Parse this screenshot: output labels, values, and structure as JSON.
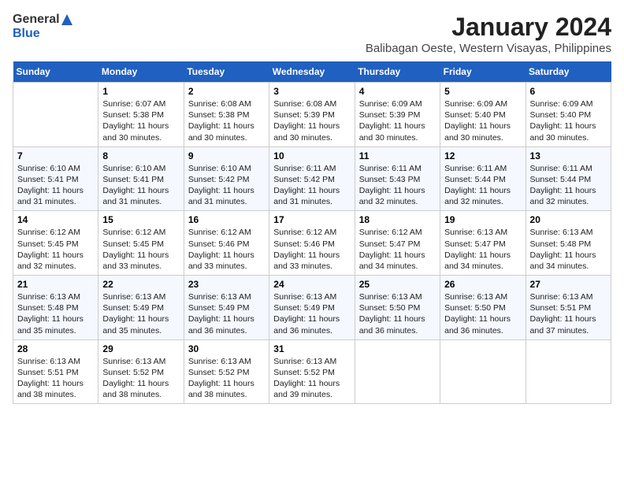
{
  "logo": {
    "line1": "General",
    "line2": "Blue"
  },
  "title": "January 2024",
  "subtitle": "Balibagan Oeste, Western Visayas, Philippines",
  "days_of_week": [
    "Sunday",
    "Monday",
    "Tuesday",
    "Wednesday",
    "Thursday",
    "Friday",
    "Saturday"
  ],
  "weeks": [
    [
      {
        "num": "",
        "sunrise": "",
        "sunset": "",
        "daylight": ""
      },
      {
        "num": "1",
        "sunrise": "Sunrise: 6:07 AM",
        "sunset": "Sunset: 5:38 PM",
        "daylight": "Daylight: 11 hours and 30 minutes."
      },
      {
        "num": "2",
        "sunrise": "Sunrise: 6:08 AM",
        "sunset": "Sunset: 5:38 PM",
        "daylight": "Daylight: 11 hours and 30 minutes."
      },
      {
        "num": "3",
        "sunrise": "Sunrise: 6:08 AM",
        "sunset": "Sunset: 5:39 PM",
        "daylight": "Daylight: 11 hours and 30 minutes."
      },
      {
        "num": "4",
        "sunrise": "Sunrise: 6:09 AM",
        "sunset": "Sunset: 5:39 PM",
        "daylight": "Daylight: 11 hours and 30 minutes."
      },
      {
        "num": "5",
        "sunrise": "Sunrise: 6:09 AM",
        "sunset": "Sunset: 5:40 PM",
        "daylight": "Daylight: 11 hours and 30 minutes."
      },
      {
        "num": "6",
        "sunrise": "Sunrise: 6:09 AM",
        "sunset": "Sunset: 5:40 PM",
        "daylight": "Daylight: 11 hours and 30 minutes."
      }
    ],
    [
      {
        "num": "7",
        "sunrise": "Sunrise: 6:10 AM",
        "sunset": "Sunset: 5:41 PM",
        "daylight": "Daylight: 11 hours and 31 minutes."
      },
      {
        "num": "8",
        "sunrise": "Sunrise: 6:10 AM",
        "sunset": "Sunset: 5:41 PM",
        "daylight": "Daylight: 11 hours and 31 minutes."
      },
      {
        "num": "9",
        "sunrise": "Sunrise: 6:10 AM",
        "sunset": "Sunset: 5:42 PM",
        "daylight": "Daylight: 11 hours and 31 minutes."
      },
      {
        "num": "10",
        "sunrise": "Sunrise: 6:11 AM",
        "sunset": "Sunset: 5:42 PM",
        "daylight": "Daylight: 11 hours and 31 minutes."
      },
      {
        "num": "11",
        "sunrise": "Sunrise: 6:11 AM",
        "sunset": "Sunset: 5:43 PM",
        "daylight": "Daylight: 11 hours and 32 minutes."
      },
      {
        "num": "12",
        "sunrise": "Sunrise: 6:11 AM",
        "sunset": "Sunset: 5:44 PM",
        "daylight": "Daylight: 11 hours and 32 minutes."
      },
      {
        "num": "13",
        "sunrise": "Sunrise: 6:11 AM",
        "sunset": "Sunset: 5:44 PM",
        "daylight": "Daylight: 11 hours and 32 minutes."
      }
    ],
    [
      {
        "num": "14",
        "sunrise": "Sunrise: 6:12 AM",
        "sunset": "Sunset: 5:45 PM",
        "daylight": "Daylight: 11 hours and 32 minutes."
      },
      {
        "num": "15",
        "sunrise": "Sunrise: 6:12 AM",
        "sunset": "Sunset: 5:45 PM",
        "daylight": "Daylight: 11 hours and 33 minutes."
      },
      {
        "num": "16",
        "sunrise": "Sunrise: 6:12 AM",
        "sunset": "Sunset: 5:46 PM",
        "daylight": "Daylight: 11 hours and 33 minutes."
      },
      {
        "num": "17",
        "sunrise": "Sunrise: 6:12 AM",
        "sunset": "Sunset: 5:46 PM",
        "daylight": "Daylight: 11 hours and 33 minutes."
      },
      {
        "num": "18",
        "sunrise": "Sunrise: 6:12 AM",
        "sunset": "Sunset: 5:47 PM",
        "daylight": "Daylight: 11 hours and 34 minutes."
      },
      {
        "num": "19",
        "sunrise": "Sunrise: 6:13 AM",
        "sunset": "Sunset: 5:47 PM",
        "daylight": "Daylight: 11 hours and 34 minutes."
      },
      {
        "num": "20",
        "sunrise": "Sunrise: 6:13 AM",
        "sunset": "Sunset: 5:48 PM",
        "daylight": "Daylight: 11 hours and 34 minutes."
      }
    ],
    [
      {
        "num": "21",
        "sunrise": "Sunrise: 6:13 AM",
        "sunset": "Sunset: 5:48 PM",
        "daylight": "Daylight: 11 hours and 35 minutes."
      },
      {
        "num": "22",
        "sunrise": "Sunrise: 6:13 AM",
        "sunset": "Sunset: 5:49 PM",
        "daylight": "Daylight: 11 hours and 35 minutes."
      },
      {
        "num": "23",
        "sunrise": "Sunrise: 6:13 AM",
        "sunset": "Sunset: 5:49 PM",
        "daylight": "Daylight: 11 hours and 36 minutes."
      },
      {
        "num": "24",
        "sunrise": "Sunrise: 6:13 AM",
        "sunset": "Sunset: 5:49 PM",
        "daylight": "Daylight: 11 hours and 36 minutes."
      },
      {
        "num": "25",
        "sunrise": "Sunrise: 6:13 AM",
        "sunset": "Sunset: 5:50 PM",
        "daylight": "Daylight: 11 hours and 36 minutes."
      },
      {
        "num": "26",
        "sunrise": "Sunrise: 6:13 AM",
        "sunset": "Sunset: 5:50 PM",
        "daylight": "Daylight: 11 hours and 36 minutes."
      },
      {
        "num": "27",
        "sunrise": "Sunrise: 6:13 AM",
        "sunset": "Sunset: 5:51 PM",
        "daylight": "Daylight: 11 hours and 37 minutes."
      }
    ],
    [
      {
        "num": "28",
        "sunrise": "Sunrise: 6:13 AM",
        "sunset": "Sunset: 5:51 PM",
        "daylight": "Daylight: 11 hours and 38 minutes."
      },
      {
        "num": "29",
        "sunrise": "Sunrise: 6:13 AM",
        "sunset": "Sunset: 5:52 PM",
        "daylight": "Daylight: 11 hours and 38 minutes."
      },
      {
        "num": "30",
        "sunrise": "Sunrise: 6:13 AM",
        "sunset": "Sunset: 5:52 PM",
        "daylight": "Daylight: 11 hours and 38 minutes."
      },
      {
        "num": "31",
        "sunrise": "Sunrise: 6:13 AM",
        "sunset": "Sunset: 5:52 PM",
        "daylight": "Daylight: 11 hours and 39 minutes."
      },
      {
        "num": "",
        "sunrise": "",
        "sunset": "",
        "daylight": ""
      },
      {
        "num": "",
        "sunrise": "",
        "sunset": "",
        "daylight": ""
      },
      {
        "num": "",
        "sunrise": "",
        "sunset": "",
        "daylight": ""
      }
    ]
  ]
}
